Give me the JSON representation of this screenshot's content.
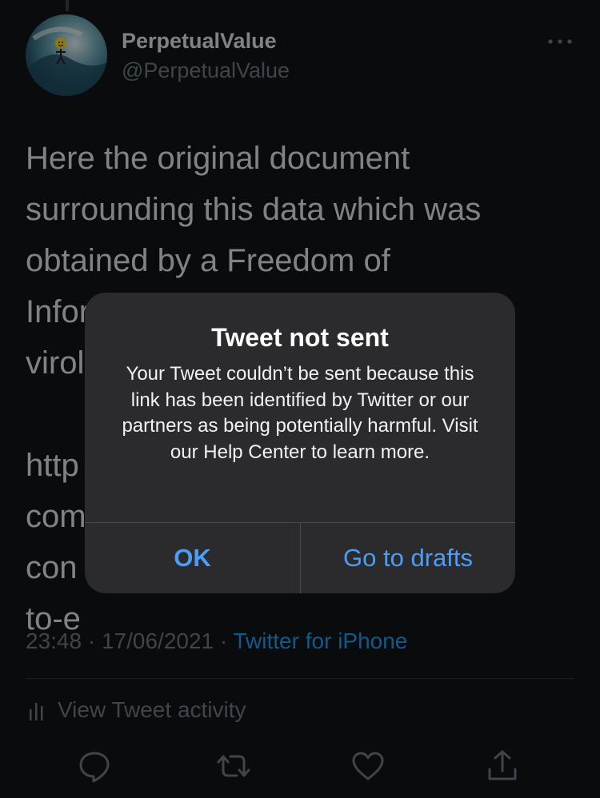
{
  "tweet": {
    "author_name": "PerpetualValue",
    "author_handle": "@PerpetualValue",
    "text": "Here the original document\nsurrounding this data which was\nobtained by a Freedom of\nInfor                                                      n\nvirol\n\nhttp\ncom\ncon                                                       d-\nto-e",
    "time": "23:48",
    "date": "17/06/2021",
    "source": "Twitter for iPhone",
    "activity_label": "View Tweet activity",
    "meta_separator": "·"
  },
  "alert": {
    "title": "Tweet not sent",
    "message": "Your Tweet couldn’t be sent because this link has been identified by Twitter or our partners as being potentially harmful. Visit our Help Center to learn more.",
    "ok_label": "OK",
    "drafts_label": "Go to drafts"
  },
  "icons": {
    "more": "more-icon",
    "reply": "reply-icon",
    "retweet": "retweet-icon",
    "like": "like-icon",
    "share": "share-icon",
    "activity": "bar-chart-icon"
  },
  "colors": {
    "background": "#101317",
    "text": "#dde0e3",
    "muted": "#6f7780",
    "link": "#1d9bf0",
    "alert_bg": "#2b2b2d",
    "alert_button": "#4c9df5"
  }
}
